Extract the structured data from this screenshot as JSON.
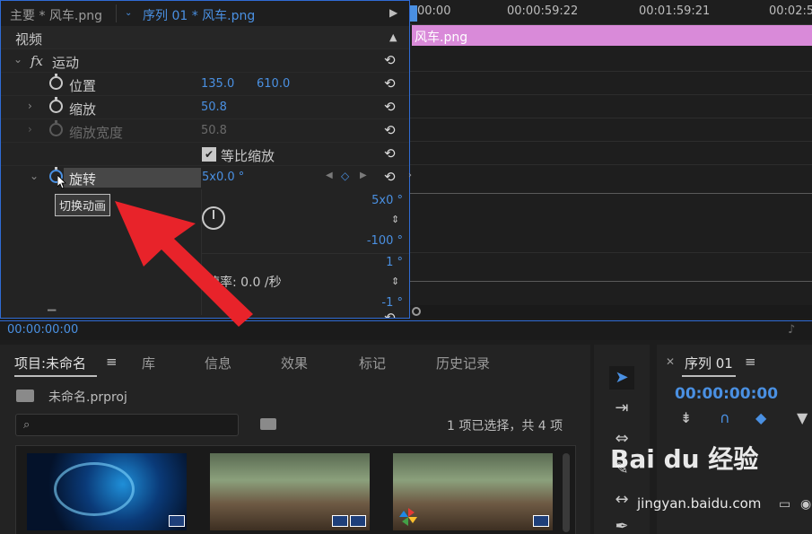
{
  "effect_controls": {
    "master_tab": "主要 * 风车.png",
    "sequence_tab": "序列 01 * 风车.png",
    "video_header": "视频",
    "fx_label": "fx",
    "motion_label": "运动",
    "position_label": "位置",
    "position_x": "135.0",
    "position_y": "610.0",
    "scale_label": "缩放",
    "scale_value": "50.8",
    "scale_width_label": "缩放宽度",
    "scale_width_value": "50.8",
    "uniform_scale_label": "等比缩放",
    "rotation_label": "旋转",
    "rotation_value": "5x0.0 °",
    "tooltip": "切换动画",
    "graph_top": "5x0 °",
    "graph_bottom": "-100 °",
    "velocity_top": "1 °",
    "velocity_bottom": "-1 °",
    "speed_label": "速率: 0.0 /秒"
  },
  "timeline": {
    "timecodes": [
      "00:00",
      "00:00:59:22",
      "00:01:59:21",
      "00:02:5"
    ],
    "clip_name": "风车.png"
  },
  "status": {
    "timecode": "00:00:00:00"
  },
  "project": {
    "tabs": [
      "项目:未命名",
      "库",
      "信息",
      "效果",
      "标记",
      "历史记录"
    ],
    "project_file": "未命名.prproj",
    "search_placeholder": "",
    "selection_info": "1 项已选择，共 4 项"
  },
  "sequence_panel": {
    "title": "序列 01",
    "timecode": "00:00:00:00"
  },
  "watermark": {
    "brand": "Bai  du 经验",
    "url": "jingyan.baidu.com"
  },
  "colors": {
    "accent": "#4a90e2",
    "clip": "#d98ad9",
    "panel_border": "#2f6bd4",
    "annotation_arrow": "#e8232a"
  }
}
